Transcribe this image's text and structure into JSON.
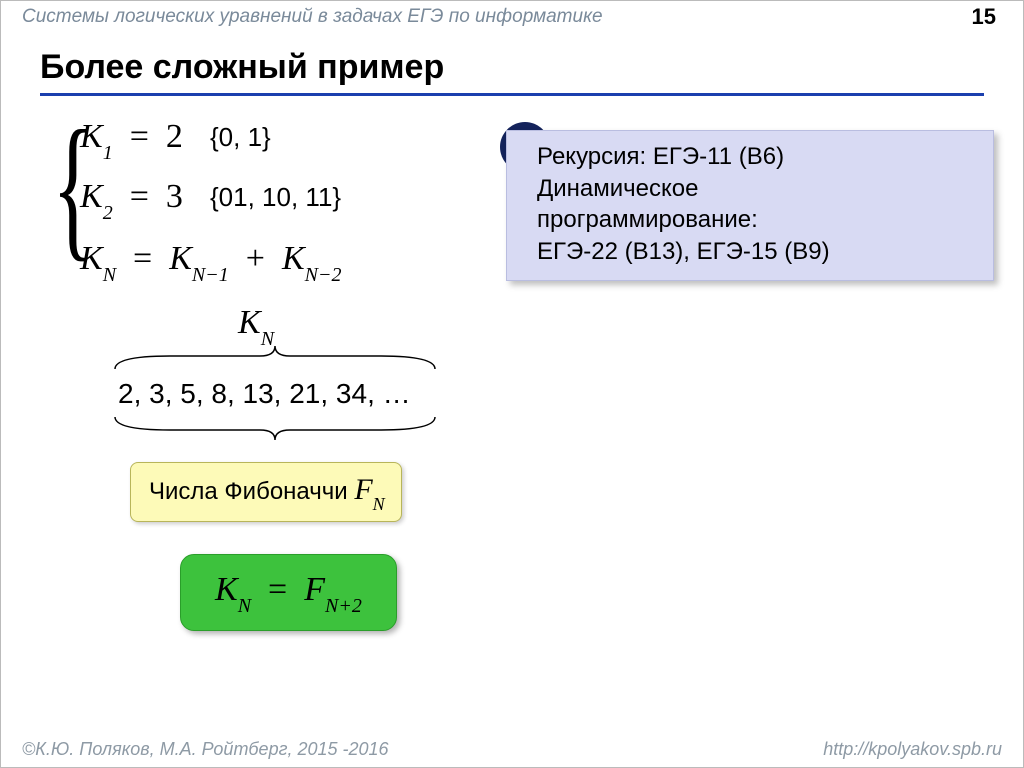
{
  "header": {
    "subject": "Системы логических уравнений в задачах ЕГЭ по информатике",
    "page": "15"
  },
  "title": "Более сложный пример",
  "system": {
    "eq1": {
      "lhs_var": "K",
      "lhs_sub": "1",
      "eq": "=",
      "rhs": "2",
      "set": "{0, 1}"
    },
    "eq2": {
      "lhs_var": "K",
      "lhs_sub": "2",
      "eq": "=",
      "rhs": "3",
      "set": "{01, 10, 11}"
    },
    "eq3": {
      "lhs_var": "K",
      "lhs_sub": "N",
      "eq": "=",
      "t1_var": "K",
      "t1_sub": "N−1",
      "plus": "+",
      "t2_var": "K",
      "t2_sub": "N−2"
    }
  },
  "note": {
    "line1": "Рекурсия: ЕГЭ-11 (B6)",
    "line2": "Динамическое",
    "line3": "программирование:",
    "line4": "ЕГЭ-22 (B13), ЕГЭ-15 (B9)",
    "bang": "!"
  },
  "kn": {
    "var": "K",
    "sub": "N"
  },
  "sequence": "2, 3, 5, 8, 13, 21, 34, …",
  "fib": {
    "label": "Числа Фибоначчи ",
    "var": "F",
    "sub": "N"
  },
  "green": {
    "l_var": "K",
    "l_sub": "N",
    "eq": "=",
    "r_var": "F",
    "r_sub": "N+2"
  },
  "footer": {
    "left": "©К.Ю. Поляков, М.А. Ройтберг, 2015 -2016",
    "right": "http://kpolyakov.spb.ru"
  }
}
